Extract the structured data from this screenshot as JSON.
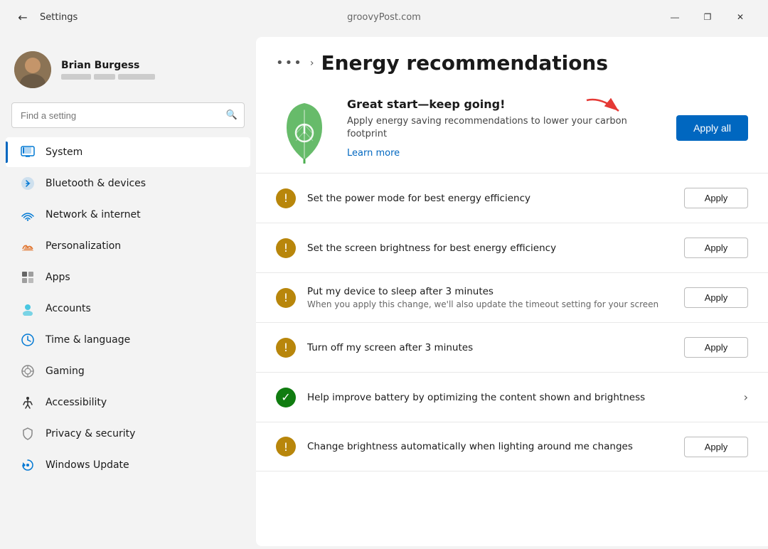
{
  "titlebar": {
    "app_name": "Settings",
    "url": "groovyPost.com",
    "controls": {
      "minimize": "—",
      "maximize": "❐",
      "close": "✕"
    }
  },
  "sidebar": {
    "search_placeholder": "Find a setting",
    "user": {
      "name": "Brian Burgess",
      "bar_widths": [
        "40px",
        "30px",
        "50px"
      ]
    },
    "nav_items": [
      {
        "id": "system",
        "label": "System",
        "active": true
      },
      {
        "id": "bluetooth",
        "label": "Bluetooth & devices"
      },
      {
        "id": "network",
        "label": "Network & internet"
      },
      {
        "id": "personalization",
        "label": "Personalization"
      },
      {
        "id": "apps",
        "label": "Apps"
      },
      {
        "id": "accounts",
        "label": "Accounts"
      },
      {
        "id": "time",
        "label": "Time & language"
      },
      {
        "id": "gaming",
        "label": "Gaming"
      },
      {
        "id": "accessibility",
        "label": "Accessibility"
      },
      {
        "id": "privacy",
        "label": "Privacy & security"
      },
      {
        "id": "update",
        "label": "Windows Update"
      }
    ]
  },
  "content": {
    "breadcrumb_dots": "•••",
    "breadcrumb_chevron": "›",
    "page_title": "Energy recommendations",
    "hero": {
      "title": "Great start—keep going!",
      "description": "Apply energy saving recommendations to lower your carbon footprint",
      "learn_more": "Learn more",
      "apply_all_label": "Apply all"
    },
    "recommendations": [
      {
        "id": "power-mode",
        "icon_type": "warning",
        "title": "Set the power mode for best energy efficiency",
        "subtitle": "",
        "action": "apply",
        "action_label": "Apply"
      },
      {
        "id": "brightness",
        "icon_type": "warning",
        "title": "Set the screen brightness for best energy efficiency",
        "subtitle": "",
        "action": "apply",
        "action_label": "Apply"
      },
      {
        "id": "sleep",
        "icon_type": "warning",
        "title": "Put my device to sleep after 3 minutes",
        "subtitle": "When you apply this change, we'll also update the timeout setting for your screen",
        "action": "apply",
        "action_label": "Apply"
      },
      {
        "id": "screen-off",
        "icon_type": "warning",
        "title": "Turn off my screen after 3 minutes",
        "subtitle": "",
        "action": "apply",
        "action_label": "Apply"
      },
      {
        "id": "battery",
        "icon_type": "success",
        "title": "Help improve battery by optimizing the content shown and brightness",
        "subtitle": "",
        "action": "chevron",
        "action_label": "›"
      },
      {
        "id": "auto-brightness",
        "icon_type": "warning",
        "title": "Change brightness automatically when lighting around me changes",
        "subtitle": "",
        "action": "apply",
        "action_label": "Apply"
      }
    ]
  }
}
